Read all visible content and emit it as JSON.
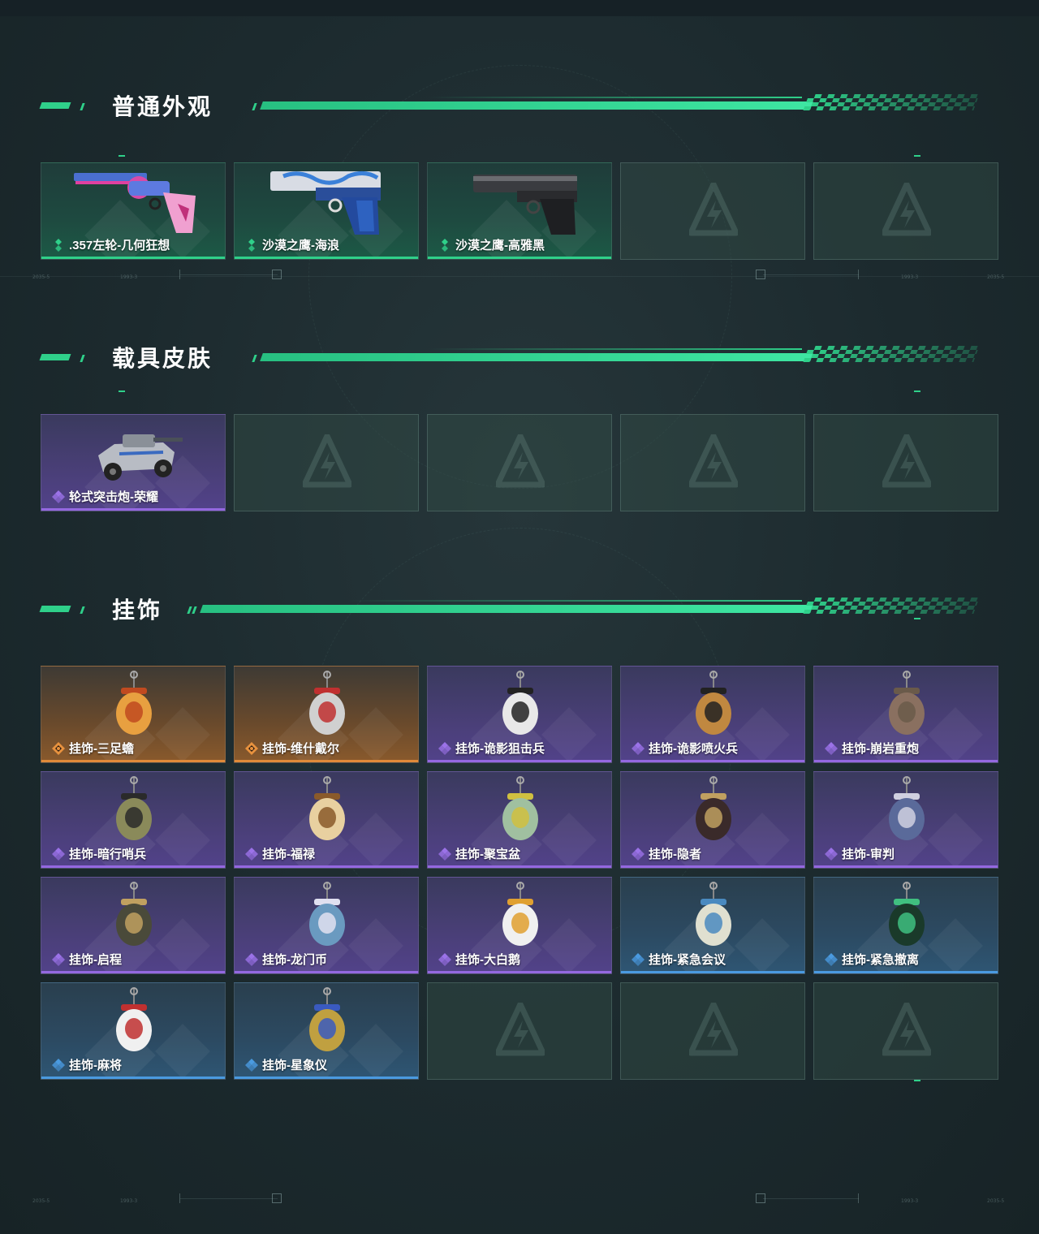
{
  "sections": [
    {
      "title": "普通外观",
      "items": [
        {
          "label": ".357左轮-几何狂想",
          "rarity": "green",
          "icon": "revolver-icon"
        },
        {
          "label": "沙漠之鹰-海浪",
          "rarity": "green",
          "icon": "pistol-wave-icon"
        },
        {
          "label": "沙漠之鹰-高雅黑",
          "rarity": "green",
          "icon": "pistol-black-icon"
        },
        {
          "label": "",
          "rarity": "empty",
          "icon": "empty-slot-logo-icon"
        },
        {
          "label": "",
          "rarity": "empty",
          "icon": "empty-slot-logo-icon"
        }
      ]
    },
    {
      "title": "载具皮肤",
      "items": [
        {
          "label": "轮式突击炮-荣耀",
          "rarity": "purple",
          "icon": "armored-vehicle-icon"
        },
        {
          "label": "",
          "rarity": "empty",
          "icon": "empty-slot-logo-icon"
        },
        {
          "label": "",
          "rarity": "empty",
          "icon": "empty-slot-logo-icon"
        },
        {
          "label": "",
          "rarity": "empty",
          "icon": "empty-slot-logo-icon"
        },
        {
          "label": "",
          "rarity": "empty",
          "icon": "empty-slot-logo-icon"
        }
      ]
    },
    {
      "title": "挂饰",
      "items": [
        {
          "label": "挂饰-三足蟾",
          "rarity": "orange",
          "icon": "toad-charm-icon"
        },
        {
          "label": "挂饰-维什戴尔",
          "rarity": "orange",
          "icon": "tag-charm-icon"
        },
        {
          "label": "挂饰-诡影狙击兵",
          "rarity": "purple",
          "icon": "sniper-charm-icon"
        },
        {
          "label": "挂饰-诡影喷火兵",
          "rarity": "purple",
          "icon": "flamer-charm-icon"
        },
        {
          "label": "挂饰-崩岩重炮",
          "rarity": "purple",
          "icon": "rock-charm-icon"
        },
        {
          "label": "挂饰-暗行哨兵",
          "rarity": "purple",
          "icon": "sentry-charm-icon"
        },
        {
          "label": "挂饰-福禄",
          "rarity": "purple",
          "icon": "gourd-charm-icon"
        },
        {
          "label": "挂饰-聚宝盆",
          "rarity": "purple",
          "icon": "treasure-bowl-charm-icon"
        },
        {
          "label": "挂饰-隐者",
          "rarity": "purple",
          "icon": "hermit-card-charm-icon"
        },
        {
          "label": "挂饰-审判",
          "rarity": "purple",
          "icon": "judgement-card-charm-icon"
        },
        {
          "label": "挂饰-启程",
          "rarity": "purple",
          "icon": "ring-charm-icon"
        },
        {
          "label": "挂饰-龙门币",
          "rarity": "purple",
          "icon": "coin-card-charm-icon"
        },
        {
          "label": "挂饰-大白鹅",
          "rarity": "purple",
          "icon": "goose-charm-icon"
        },
        {
          "label": "挂饰-紧急会议",
          "rarity": "blue",
          "icon": "meeting-charm-icon"
        },
        {
          "label": "挂饰-紧急撤离",
          "rarity": "blue",
          "icon": "evac-charm-icon"
        },
        {
          "label": "挂饰-麻将",
          "rarity": "blue",
          "icon": "mahjong-charm-icon"
        },
        {
          "label": "挂饰-星象仪",
          "rarity": "blue",
          "icon": "astrolabe-charm-icon"
        },
        {
          "label": "",
          "rarity": "empty",
          "icon": "empty-slot-logo-icon"
        },
        {
          "label": "",
          "rarity": "empty",
          "icon": "empty-slot-logo-icon"
        },
        {
          "label": "",
          "rarity": "empty",
          "icon": "empty-slot-logo-icon"
        }
      ]
    }
  ],
  "colors": {
    "accent": "#2fd08a",
    "green": "#2fd08a",
    "purple": "#9468e0",
    "orange": "#e08a3a",
    "blue": "#4a9ae0"
  }
}
